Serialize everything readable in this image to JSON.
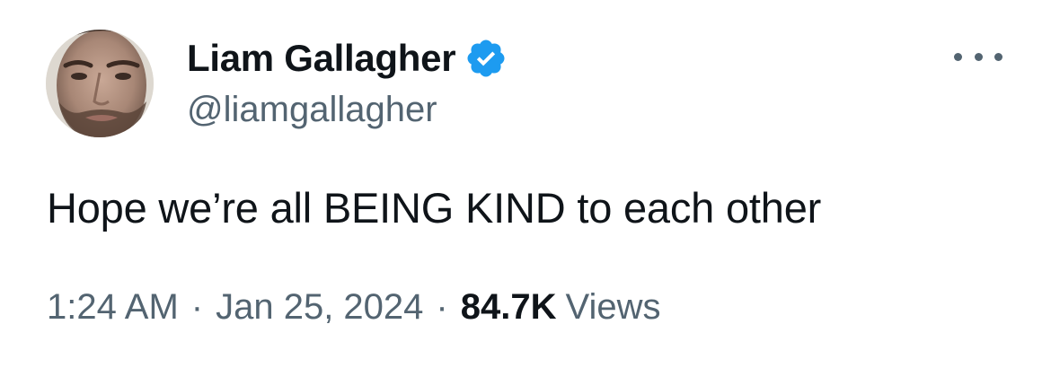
{
  "author": {
    "display_name": "Liam Gallagher",
    "handle": "@liamgallagher",
    "verified": true
  },
  "tweet": {
    "text": "Hope we’re all BEING KIND to each other"
  },
  "meta": {
    "time": "1:24 AM",
    "separator": "·",
    "date": "Jan 25, 2024",
    "views_count": "84.7K",
    "views_label": "Views"
  },
  "icons": {
    "verified": "verified-badge-icon",
    "more": "more-options-icon"
  },
  "colors": {
    "primary_text": "#0f1419",
    "secondary_text": "#536471",
    "verified_blue": "#1d9bf0",
    "background": "#ffffff"
  }
}
